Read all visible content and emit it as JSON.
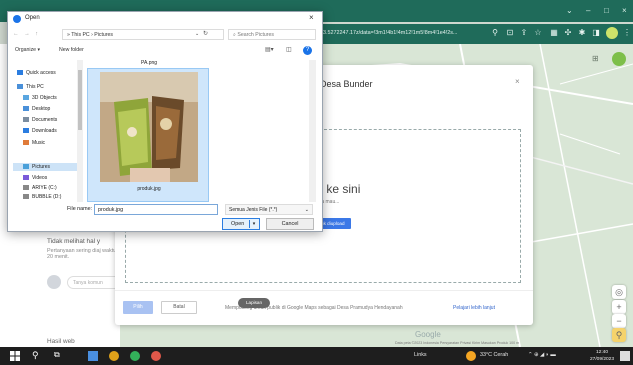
{
  "browser": {
    "url": "13.5272247.17z/data=!3m1!4b1!4m12!1m5!8m4!1e4!2s...",
    "ext_colors": [
      "#cde36a",
      "#f08a4b"
    ]
  },
  "upload_dialog": {
    "title": "Desa Bunder",
    "drag_text": "to ke sini",
    "or_text": "anda mau...",
    "select_label": "ruk diupload",
    "footer_select": "Pilih",
    "footer_cancel": "Batal",
    "footer_note": "Memposting untuk publik di Google Maps sebagai Desa Pramudya Hendayanah",
    "learn_more": "Pelajari lebih lanjut"
  },
  "left_panel": {
    "notice_title": "Tidak melihat hal y",
    "notice_body": "Pertanyaan sering diaj waktu 20 menit.",
    "ask_placeholder": "Tanya komun",
    "results_heading": "Hasil web"
  },
  "map": {
    "layers_label": "Lapisan",
    "google": "Google",
    "credit": "Data peta ©2023   Indonesia   Persyaratan   Privasi   Kirim Masukan Produk   100 m"
  },
  "open_dialog": {
    "title": "Open",
    "close": "×",
    "nav_arrows": "← → ↑",
    "breadcrumb": "» This PC › Pictures",
    "search_placeholder": "Search Pictures",
    "organize": "Organize ▾",
    "new_folder": "New folder",
    "nav_items": [
      {
        "label": "Quick access",
        "color": "#2b7de0"
      },
      {
        "label": "This PC",
        "color": "#4a90d9"
      },
      {
        "label": "3D Objects",
        "color": "#5aa6e0"
      },
      {
        "label": "Desktop",
        "color": "#4a90d9"
      },
      {
        "label": "Documents",
        "color": "#7b8da0"
      },
      {
        "label": "Downloads",
        "color": "#2b7de0"
      },
      {
        "label": "Music",
        "color": "#e07b39"
      },
      {
        "label": "Pictures",
        "color": "#4aa0d9"
      },
      {
        "label": "Videos",
        "color": "#7b5ad9"
      },
      {
        "label": "ARIYE (C:)",
        "color": "#888888"
      },
      {
        "label": "BUBBLE (D:)",
        "color": "#888888"
      }
    ],
    "file_above": "PA.png",
    "file_name": "produk.jpg",
    "filename_label": "File name:",
    "filename_value": "produk.jpg",
    "filetype_value": "Semua Jenis File (*.*)",
    "open_label": "Open",
    "cancel_label": "Cancel"
  },
  "taskbar": {
    "links": "Links",
    "weather": "33°C  Cerah",
    "time": "12:40",
    "date": "27/09/2023"
  }
}
